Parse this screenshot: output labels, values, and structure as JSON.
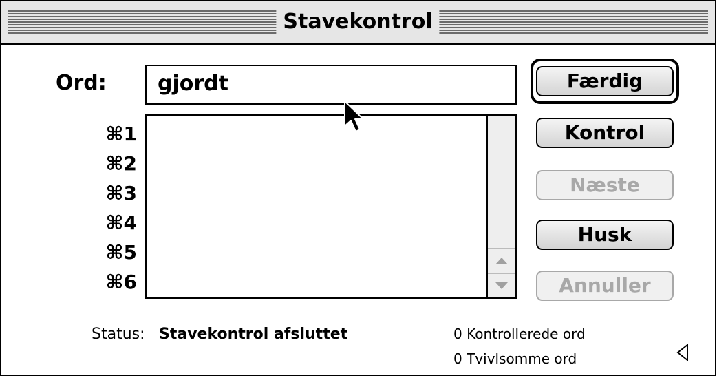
{
  "window": {
    "title": "Stavekontrol"
  },
  "word": {
    "label": "Ord:",
    "value": "gjordt"
  },
  "suggestions": {
    "shortcuts": [
      "⌘1",
      "⌘2",
      "⌘3",
      "⌘4",
      "⌘5",
      "⌘6"
    ],
    "items": []
  },
  "buttons": {
    "done": "Færdig",
    "check": "Kontrol",
    "next": "Næste",
    "remember": "Husk",
    "cancel": "Annuller"
  },
  "status": {
    "label": "Status:",
    "value": "Stavekontrol afsluttet",
    "checked_words": "0 Kontrollerede ord",
    "doubtful_words": "0 Tvivlsomme ord"
  },
  "icons": {
    "cursor": "arrow-cursor-icon",
    "scroll_up": "scroll-up-arrow-icon",
    "scroll_down": "scroll-down-arrow-icon",
    "disclosure": "disclosure-triangle-icon"
  }
}
